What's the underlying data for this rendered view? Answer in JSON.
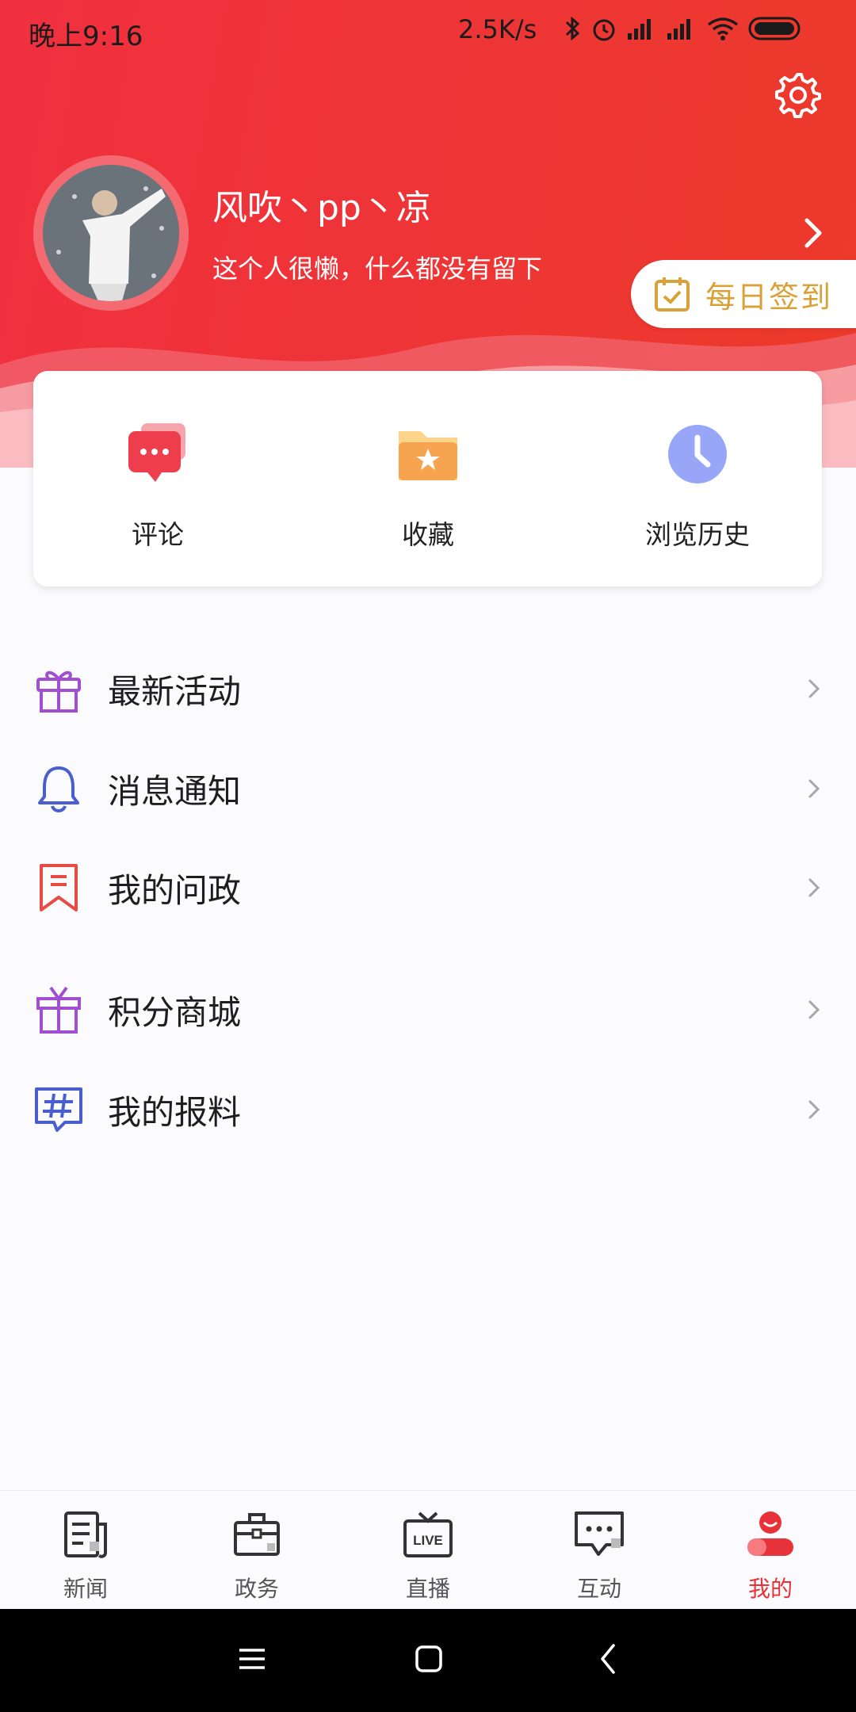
{
  "status_bar": {
    "time": "晚上9:16",
    "speed": "2.5K/s"
  },
  "profile": {
    "username": "风吹丶pp丶凉",
    "bio": "这个人很懒，什么都没有留下"
  },
  "checkin": {
    "label": "每日签到"
  },
  "quick_actions": [
    {
      "label": "评论",
      "icon": "comment-icon"
    },
    {
      "label": "收藏",
      "icon": "folder-star-icon"
    },
    {
      "label": "浏览历史",
      "icon": "clock-icon"
    }
  ],
  "menu": [
    {
      "label": "最新活动",
      "icon": "gift-icon"
    },
    {
      "label": "消息通知",
      "icon": "bell-icon"
    },
    {
      "label": "我的问政",
      "icon": "bookmark-icon"
    },
    {
      "label": "积分商城",
      "icon": "present-icon"
    },
    {
      "label": "我的报料",
      "icon": "hashtag-chat-icon"
    }
  ],
  "bottom_nav": [
    {
      "label": "新闻",
      "icon": "news-icon"
    },
    {
      "label": "政务",
      "icon": "briefcase-icon"
    },
    {
      "label": "直播",
      "icon": "live-tv-icon"
    },
    {
      "label": "互动",
      "icon": "chat-icon"
    },
    {
      "label": "我的",
      "icon": "me-icon",
      "active": true
    }
  ],
  "colors": {
    "brand_red": "#e8323a",
    "checkin_gold": "#d9a137"
  }
}
